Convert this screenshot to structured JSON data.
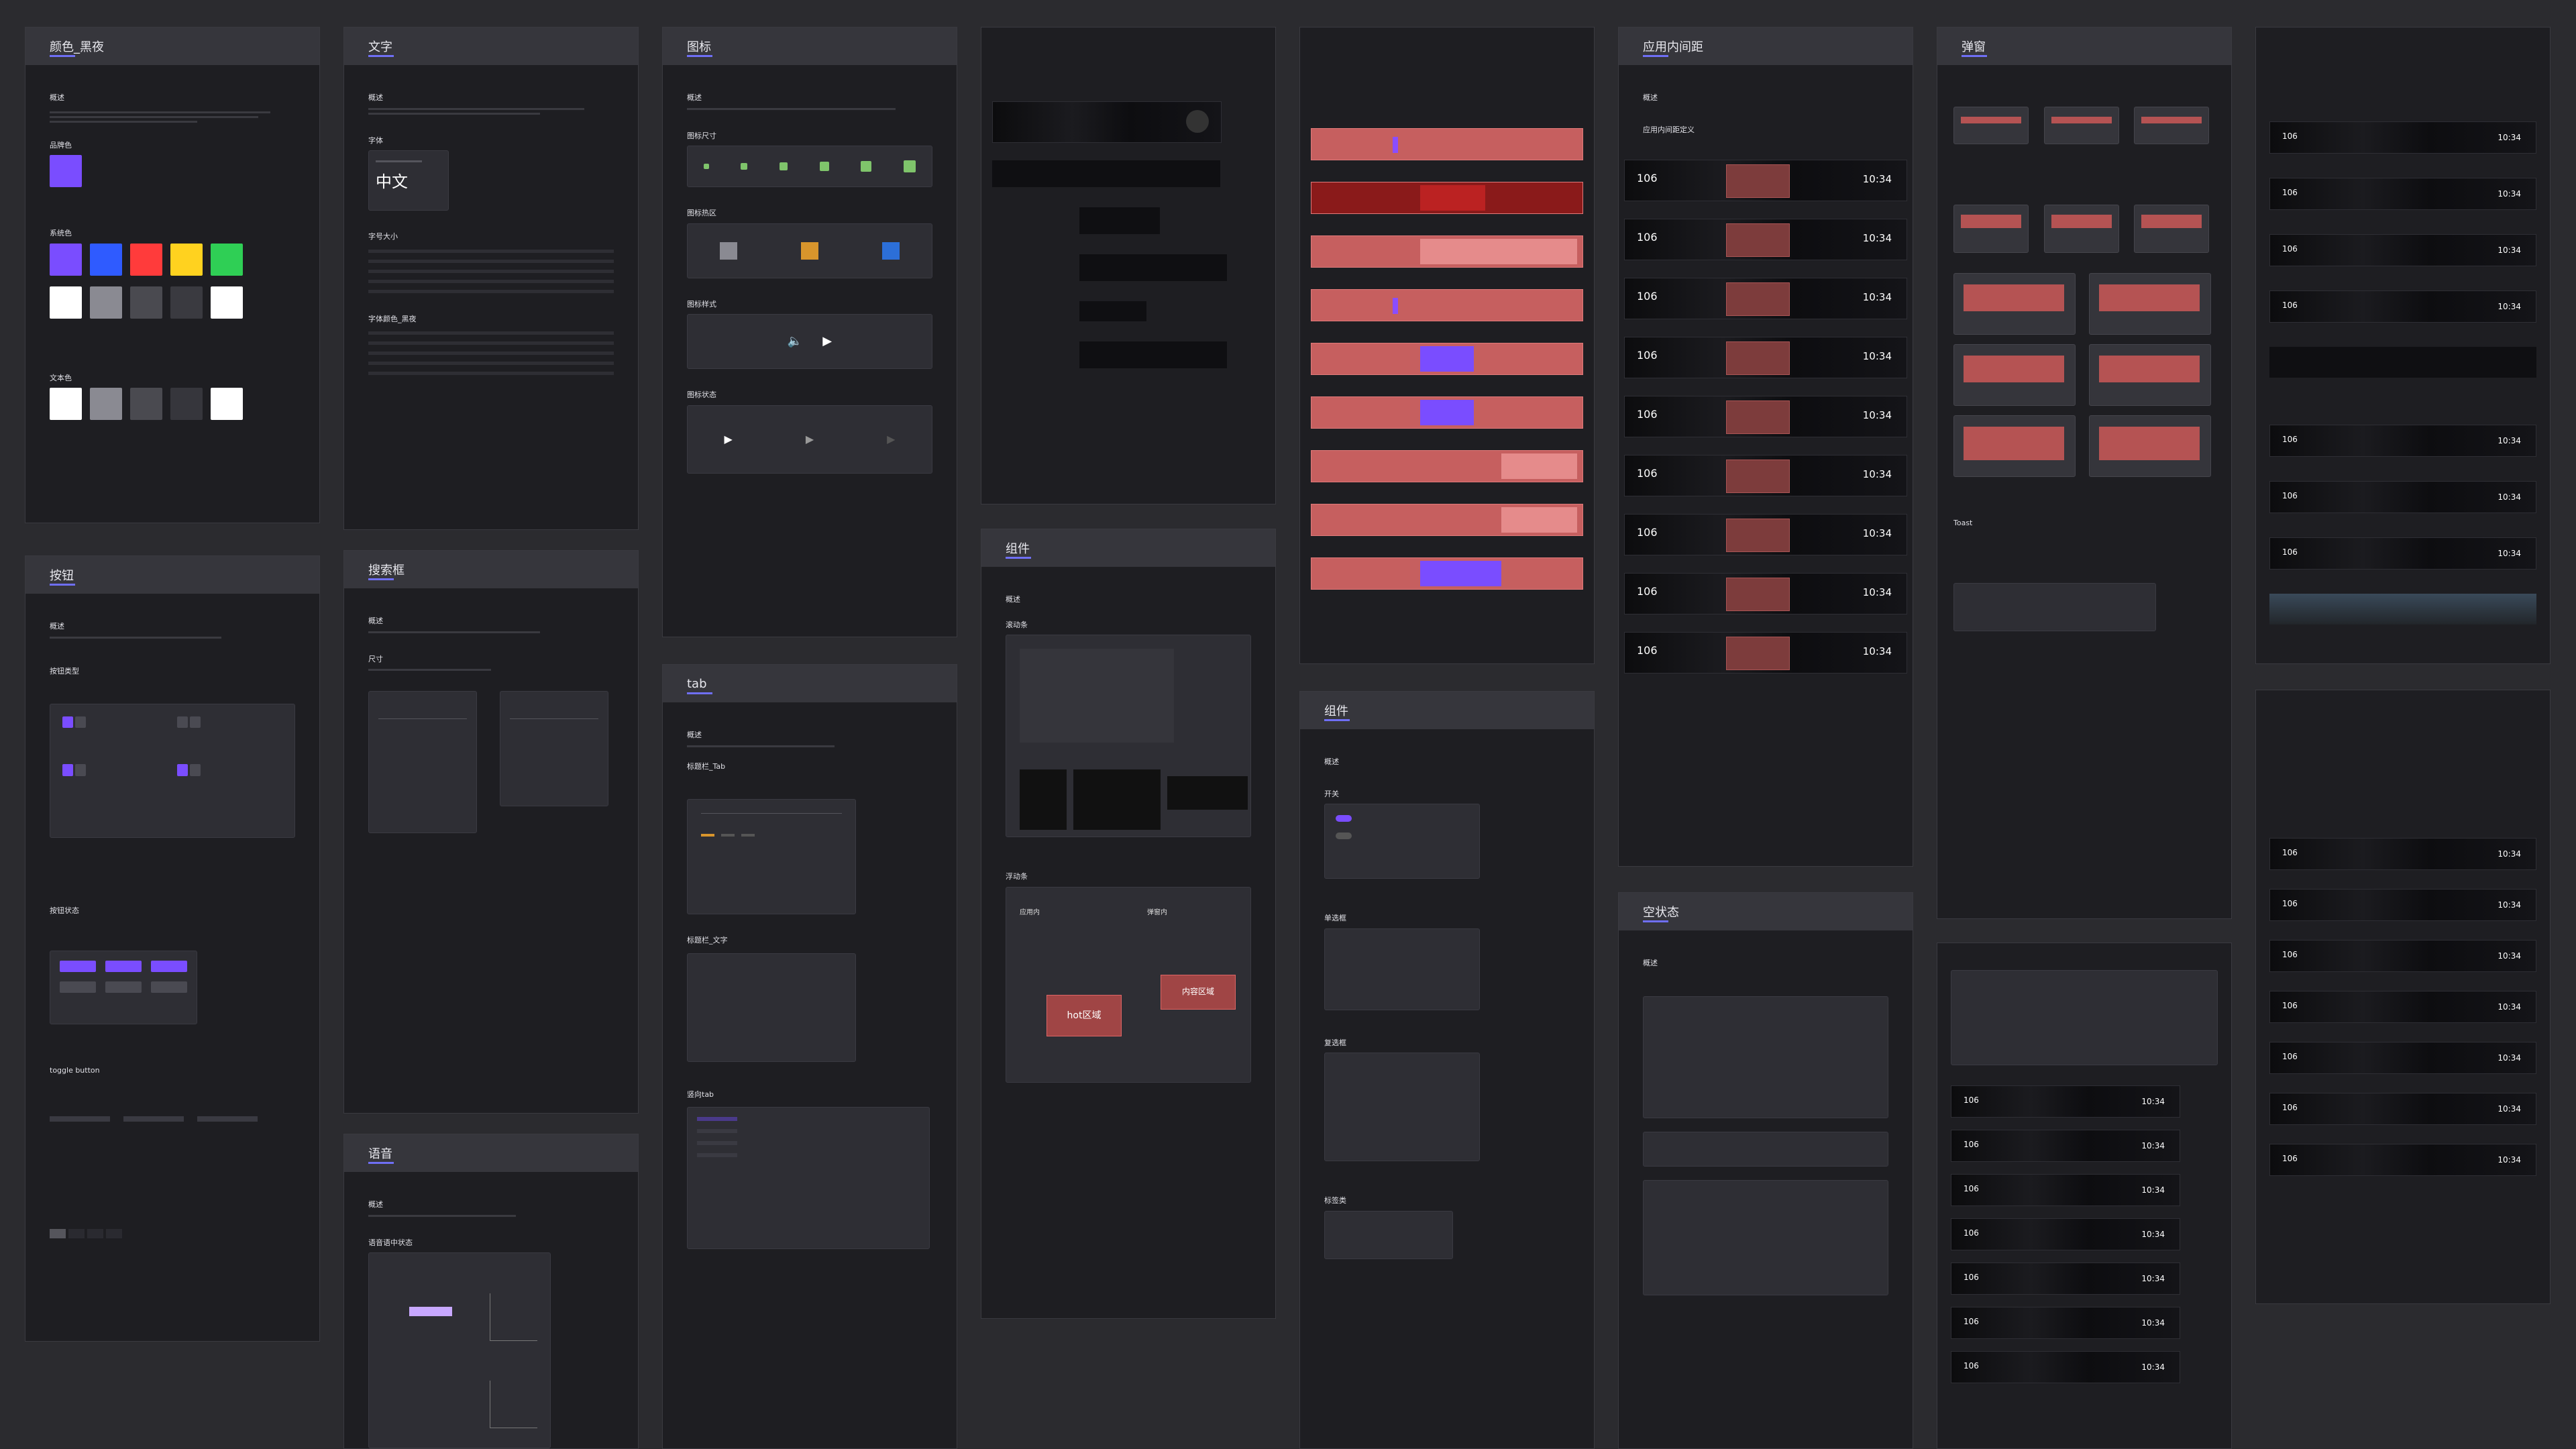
{
  "boards": {
    "color": {
      "title": "颜色_黑夜",
      "overview": "概述",
      "brand": "品牌色",
      "system": "系统色",
      "text": "文本色",
      "brand_color": "#7a4dff",
      "system_colors": [
        "#7a4dff",
        "#2f5bff",
        "#ff3b3b",
        "#ffd21f",
        "#2fcf55"
      ]
    },
    "text": {
      "title": "文字",
      "overview": "概述",
      "font": "字体",
      "sample": "中文",
      "sizes": "字号大小",
      "font_colors": "字体颜色_黑夜"
    },
    "icon": {
      "title": "图标",
      "overview": "概述",
      "icon_size": "图标尺寸",
      "hot_area": "图标热区",
      "style": "图标样式",
      "state": "图标状态"
    },
    "button": {
      "title": "按钮",
      "overview": "概述",
      "types": "按钮类型",
      "states": "按钮状态",
      "toggle": "toggle button"
    },
    "search": {
      "title": "搜索框",
      "overview": "概述",
      "size": "尺寸"
    },
    "voice": {
      "title": "语音",
      "overview": "概述",
      "state": "语音语中状态"
    },
    "tab": {
      "title": "tab",
      "overview": "概述",
      "tab1": "标题栏_Tab",
      "tab2": "标题栏_文字",
      "tab3": "竖向tab"
    },
    "component1": {
      "title": "组件",
      "overview": "概述",
      "scroll": "滚动条",
      "float": "浮动条",
      "in_app": "应用内",
      "in_popup": "弹窗内",
      "hot": "hot区域",
      "content": "内容区域"
    },
    "component2": {
      "title": "组件",
      "overview": "概述",
      "switch": "开关",
      "radio": "单选框",
      "checkbox": "复选框",
      "tag": "标签类"
    },
    "inapp": {
      "title": "应用内间距",
      "overview": "概述",
      "def": "应用内间距定义",
      "speed": "106",
      "time": "10:34"
    },
    "empty": {
      "title": "空状态",
      "overview": "概述"
    },
    "popup": {
      "title": "弹窗",
      "toast": "Toast"
    }
  }
}
